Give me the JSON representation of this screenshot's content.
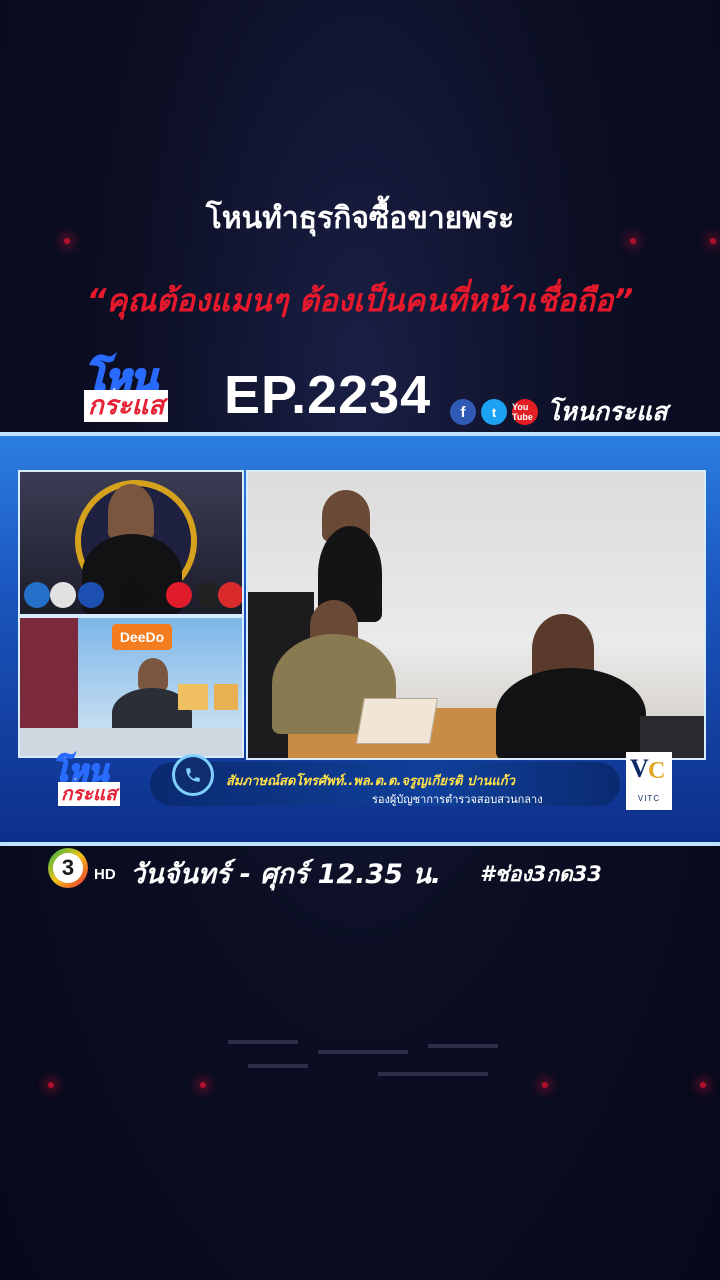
{
  "headline": "โหนทำธุรกิจซื้อขายพระ",
  "quote": "“คุณต้องแมนๆ ต้องเป็นคนที่หน้าเชื่อถือ”",
  "show_logo": {
    "top": "โหน",
    "bottom": "กระแส"
  },
  "episode": "EP.2234",
  "social": {
    "icons": [
      "facebook-icon",
      "twitter-icon",
      "youtube-icon"
    ],
    "fb_glyph": "f",
    "tw_glyph": "t",
    "yt_glyph": "You Tube",
    "name": "โหนกระแส"
  },
  "broadcast": {
    "panel_b_sign": "DeeDo",
    "caption_line1": "สัมภาษณ์สดโทรศัพท์..พล.ต.ต.จรูญเกียรติ ปานแก้ว",
    "caption_line2": "รองผู้บัญชาการตำรวจสอบสวนกลาง",
    "lower_logo": {
      "top": "โหน",
      "bottom": "กระแส"
    },
    "vitc": {
      "v": "V",
      "c": "C",
      "text": "VITC"
    }
  },
  "schedule": {
    "channel": "3",
    "hd": "HD",
    "time": "วันจันทร์ - ศุกร์ 12.35 น.",
    "hashtag": "#ช่อง3กด33"
  },
  "colors": {
    "accent_red": "#e8192c",
    "frame_blue": "#1b58c0",
    "caption_yellow": "#ffe14a"
  }
}
